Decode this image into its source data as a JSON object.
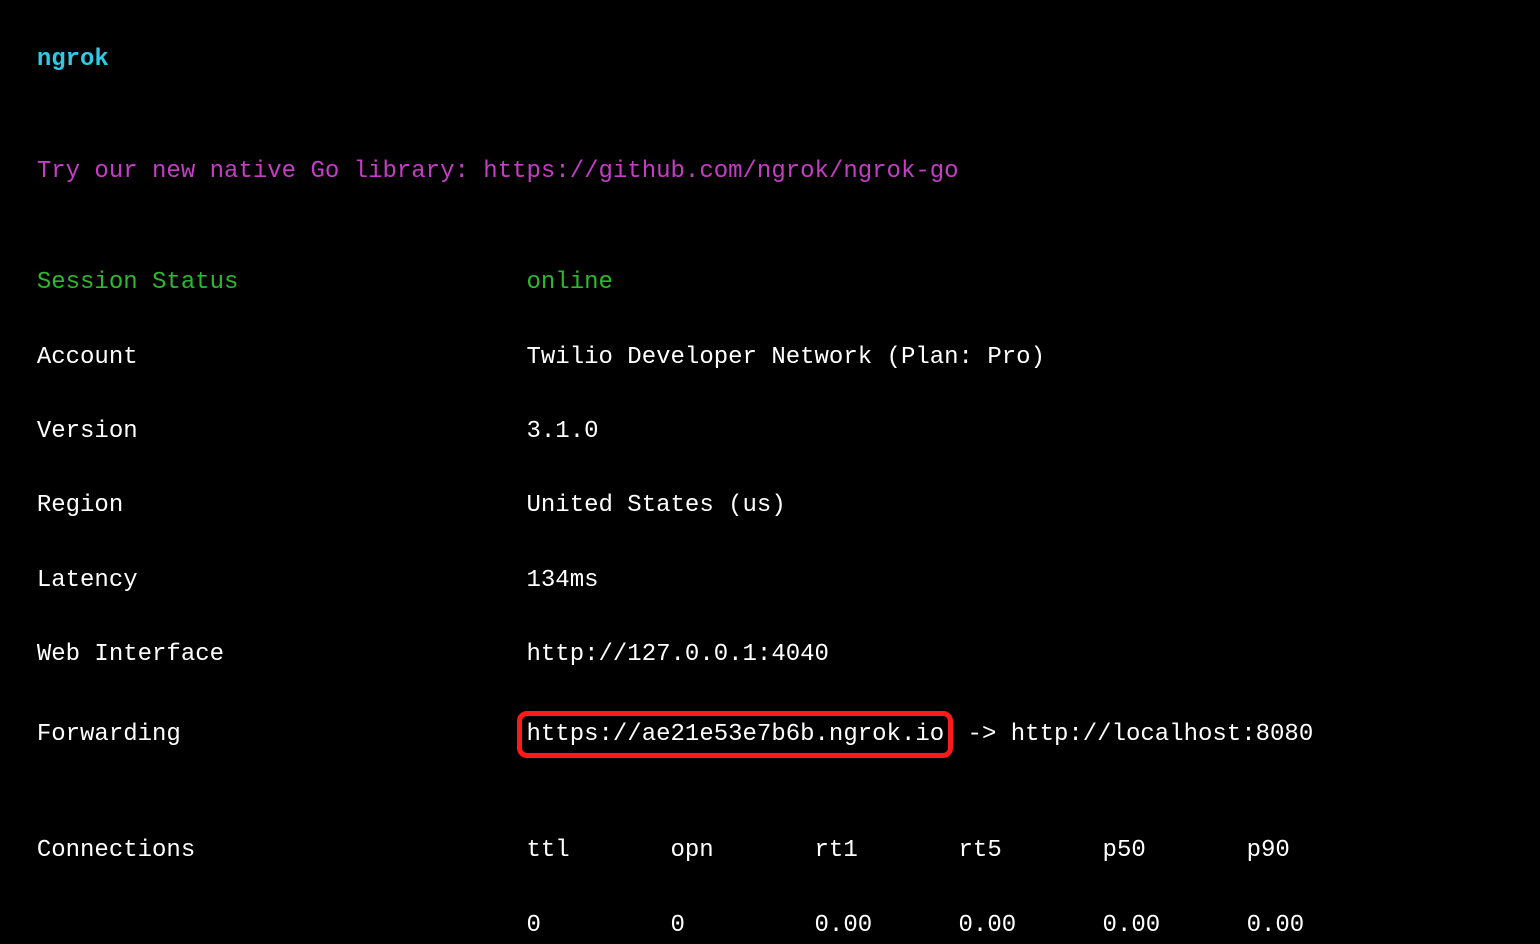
{
  "header": {
    "title": "ngrok"
  },
  "promo": {
    "text": "Try our new native Go library: https://github.com/ngrok/ngrok-go"
  },
  "status": {
    "sessionStatusLabel": "Session Status",
    "sessionStatusValue": "online",
    "accountLabel": "Account",
    "accountValue": "Twilio Developer Network (Plan: Pro)",
    "versionLabel": "Version",
    "versionValue": "3.1.0",
    "regionLabel": "Region",
    "regionValue": "United States (us)",
    "latencyLabel": "Latency",
    "latencyValue": "134ms",
    "webInterfaceLabel": "Web Interface",
    "webInterfaceValue": "http://127.0.0.1:4040",
    "forwardingLabel": "Forwarding",
    "forwardingUrl": "https://ae21e53e7b6b.ngrok.io",
    "forwardingArrow": " -> ",
    "forwardingTarget": "http://localhost:8080"
  },
  "connections": {
    "label": "Connections",
    "headers": [
      "ttl",
      "opn",
      "rt1",
      "rt5",
      "p50",
      "p90"
    ],
    "values": [
      "0",
      "0",
      "0.00",
      "0.00",
      "0.00",
      "0.00"
    ]
  }
}
